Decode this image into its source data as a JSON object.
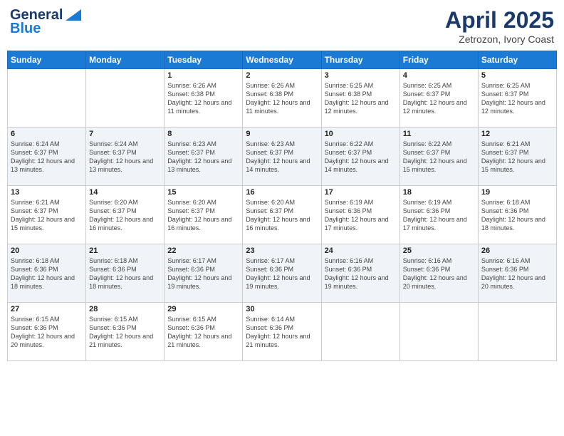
{
  "header": {
    "logo_general": "General",
    "logo_blue": "Blue",
    "title": "April 2025",
    "subtitle": "Zetrozon, Ivory Coast"
  },
  "weekdays": [
    "Sunday",
    "Monday",
    "Tuesday",
    "Wednesday",
    "Thursday",
    "Friday",
    "Saturday"
  ],
  "weeks": [
    [
      {
        "day": "",
        "info": ""
      },
      {
        "day": "",
        "info": ""
      },
      {
        "day": "1",
        "info": "Sunrise: 6:26 AM\nSunset: 6:38 PM\nDaylight: 12 hours and 11 minutes."
      },
      {
        "day": "2",
        "info": "Sunrise: 6:26 AM\nSunset: 6:38 PM\nDaylight: 12 hours and 11 minutes."
      },
      {
        "day": "3",
        "info": "Sunrise: 6:25 AM\nSunset: 6:38 PM\nDaylight: 12 hours and 12 minutes."
      },
      {
        "day": "4",
        "info": "Sunrise: 6:25 AM\nSunset: 6:37 PM\nDaylight: 12 hours and 12 minutes."
      },
      {
        "day": "5",
        "info": "Sunrise: 6:25 AM\nSunset: 6:37 PM\nDaylight: 12 hours and 12 minutes."
      }
    ],
    [
      {
        "day": "6",
        "info": "Sunrise: 6:24 AM\nSunset: 6:37 PM\nDaylight: 12 hours and 13 minutes."
      },
      {
        "day": "7",
        "info": "Sunrise: 6:24 AM\nSunset: 6:37 PM\nDaylight: 12 hours and 13 minutes."
      },
      {
        "day": "8",
        "info": "Sunrise: 6:23 AM\nSunset: 6:37 PM\nDaylight: 12 hours and 13 minutes."
      },
      {
        "day": "9",
        "info": "Sunrise: 6:23 AM\nSunset: 6:37 PM\nDaylight: 12 hours and 14 minutes."
      },
      {
        "day": "10",
        "info": "Sunrise: 6:22 AM\nSunset: 6:37 PM\nDaylight: 12 hours and 14 minutes."
      },
      {
        "day": "11",
        "info": "Sunrise: 6:22 AM\nSunset: 6:37 PM\nDaylight: 12 hours and 15 minutes."
      },
      {
        "day": "12",
        "info": "Sunrise: 6:21 AM\nSunset: 6:37 PM\nDaylight: 12 hours and 15 minutes."
      }
    ],
    [
      {
        "day": "13",
        "info": "Sunrise: 6:21 AM\nSunset: 6:37 PM\nDaylight: 12 hours and 15 minutes."
      },
      {
        "day": "14",
        "info": "Sunrise: 6:20 AM\nSunset: 6:37 PM\nDaylight: 12 hours and 16 minutes."
      },
      {
        "day": "15",
        "info": "Sunrise: 6:20 AM\nSunset: 6:37 PM\nDaylight: 12 hours and 16 minutes."
      },
      {
        "day": "16",
        "info": "Sunrise: 6:20 AM\nSunset: 6:37 PM\nDaylight: 12 hours and 16 minutes."
      },
      {
        "day": "17",
        "info": "Sunrise: 6:19 AM\nSunset: 6:36 PM\nDaylight: 12 hours and 17 minutes."
      },
      {
        "day": "18",
        "info": "Sunrise: 6:19 AM\nSunset: 6:36 PM\nDaylight: 12 hours and 17 minutes."
      },
      {
        "day": "19",
        "info": "Sunrise: 6:18 AM\nSunset: 6:36 PM\nDaylight: 12 hours and 18 minutes."
      }
    ],
    [
      {
        "day": "20",
        "info": "Sunrise: 6:18 AM\nSunset: 6:36 PM\nDaylight: 12 hours and 18 minutes."
      },
      {
        "day": "21",
        "info": "Sunrise: 6:18 AM\nSunset: 6:36 PM\nDaylight: 12 hours and 18 minutes."
      },
      {
        "day": "22",
        "info": "Sunrise: 6:17 AM\nSunset: 6:36 PM\nDaylight: 12 hours and 19 minutes."
      },
      {
        "day": "23",
        "info": "Sunrise: 6:17 AM\nSunset: 6:36 PM\nDaylight: 12 hours and 19 minutes."
      },
      {
        "day": "24",
        "info": "Sunrise: 6:16 AM\nSunset: 6:36 PM\nDaylight: 12 hours and 19 minutes."
      },
      {
        "day": "25",
        "info": "Sunrise: 6:16 AM\nSunset: 6:36 PM\nDaylight: 12 hours and 20 minutes."
      },
      {
        "day": "26",
        "info": "Sunrise: 6:16 AM\nSunset: 6:36 PM\nDaylight: 12 hours and 20 minutes."
      }
    ],
    [
      {
        "day": "27",
        "info": "Sunrise: 6:15 AM\nSunset: 6:36 PM\nDaylight: 12 hours and 20 minutes."
      },
      {
        "day": "28",
        "info": "Sunrise: 6:15 AM\nSunset: 6:36 PM\nDaylight: 12 hours and 21 minutes."
      },
      {
        "day": "29",
        "info": "Sunrise: 6:15 AM\nSunset: 6:36 PM\nDaylight: 12 hours and 21 minutes."
      },
      {
        "day": "30",
        "info": "Sunrise: 6:14 AM\nSunset: 6:36 PM\nDaylight: 12 hours and 21 minutes."
      },
      {
        "day": "",
        "info": ""
      },
      {
        "day": "",
        "info": ""
      },
      {
        "day": "",
        "info": ""
      }
    ]
  ]
}
